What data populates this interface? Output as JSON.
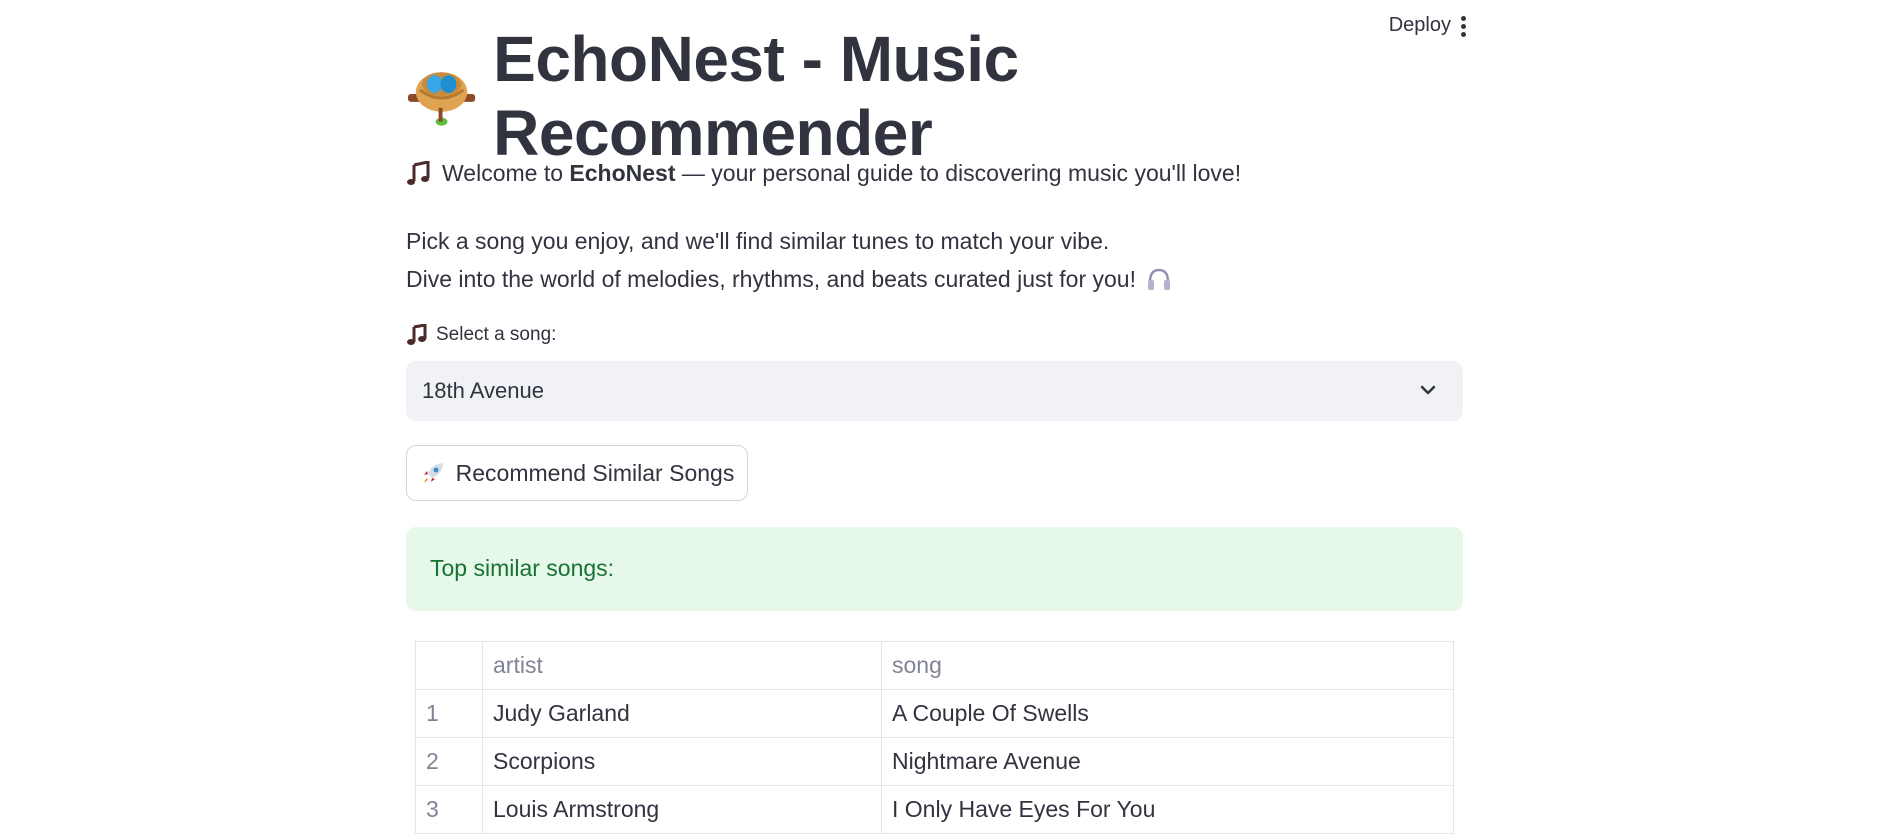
{
  "header": {
    "deploy_label": "Deploy"
  },
  "title": {
    "text": "EchoNest - Music Recommender",
    "icon": "nest-icon"
  },
  "welcome": {
    "prefix": "Welcome to ",
    "brand": "EchoNest",
    "suffix": " — your personal guide to discovering music you'll love!",
    "icon": "notes-icon"
  },
  "intro": {
    "line1": "Pick a song you enjoy, and we'll find similar tunes to match your vibe.",
    "line2": "Dive into the world of melodies, rhythms, and beats curated just for you!",
    "line2_icon": "headphone-icon"
  },
  "select": {
    "label": "Select a song:",
    "label_icon": "note-icon",
    "value": "18th Avenue"
  },
  "recommend_button": {
    "label": "Recommend Similar Songs",
    "icon": "rocket-icon"
  },
  "success": {
    "text": "Top similar songs:"
  },
  "table": {
    "columns": [
      "",
      "artist",
      "song"
    ],
    "rows": [
      {
        "index": "1",
        "artist": "Judy Garland",
        "song": "A Couple Of Swells"
      },
      {
        "index": "2",
        "artist": "Scorpions",
        "song": "Nightmare Avenue"
      },
      {
        "index": "3",
        "artist": "Louis Armstrong",
        "song": "I Only Have Eyes For You"
      }
    ]
  },
  "colors": {
    "text": "#31333f",
    "select_bg": "#f0f2f6",
    "success_bg": "#e6f8ea",
    "success_text": "#177233"
  }
}
